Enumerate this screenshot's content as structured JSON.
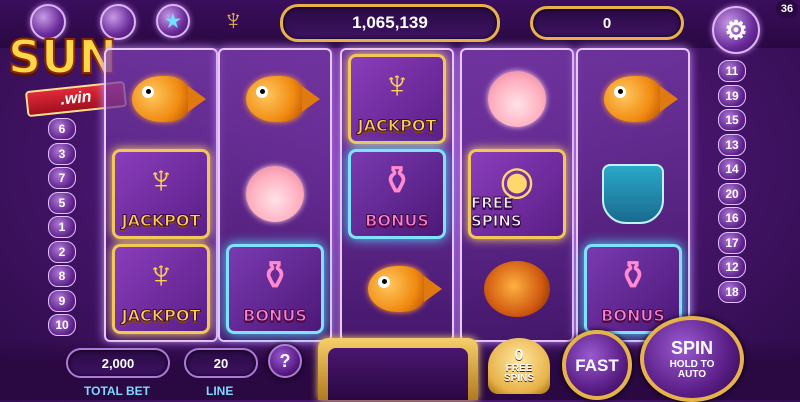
{
  "logo": {
    "top": "SUN",
    "bottom": ".win"
  },
  "header": {
    "balance": "1,065,139",
    "win": "0",
    "badge": "36"
  },
  "lines_left": [
    "6",
    "3",
    "7",
    "5",
    "1",
    "2",
    "8",
    "9",
    "10"
  ],
  "lines_right": [
    "11",
    "19",
    "15",
    "13",
    "14",
    "20",
    "16",
    "17",
    "12",
    "18"
  ],
  "reels": [
    [
      "fish",
      "jackpot",
      "jackpot"
    ],
    [
      "fish",
      "shell",
      "bonus"
    ],
    [
      "jackpot",
      "bonus",
      "fish"
    ],
    [
      "shell",
      "free_spins",
      "angler"
    ],
    [
      "fish",
      "worm",
      "bonus"
    ]
  ],
  "symbols": {
    "jackpot": "JACKPOT",
    "bonus": "BONUS",
    "free_spins": "FREE SPINS"
  },
  "bottom": {
    "total_bet_value": "2,000",
    "total_bet_label": "TOTAL BET",
    "line_value": "20",
    "line_label": "LINE",
    "help": "?",
    "free_spins_count": "0",
    "free_spins_label1": "FREE",
    "free_spins_label2": "SPINS",
    "fast": "FAST",
    "spin": "SPIN",
    "spin_sub1": "HOLD TO",
    "spin_sub2": "AUTO"
  },
  "colors": {
    "gold": "#e8b24a",
    "purple": "#5a1e86",
    "cyan": "#7fd8ff"
  }
}
